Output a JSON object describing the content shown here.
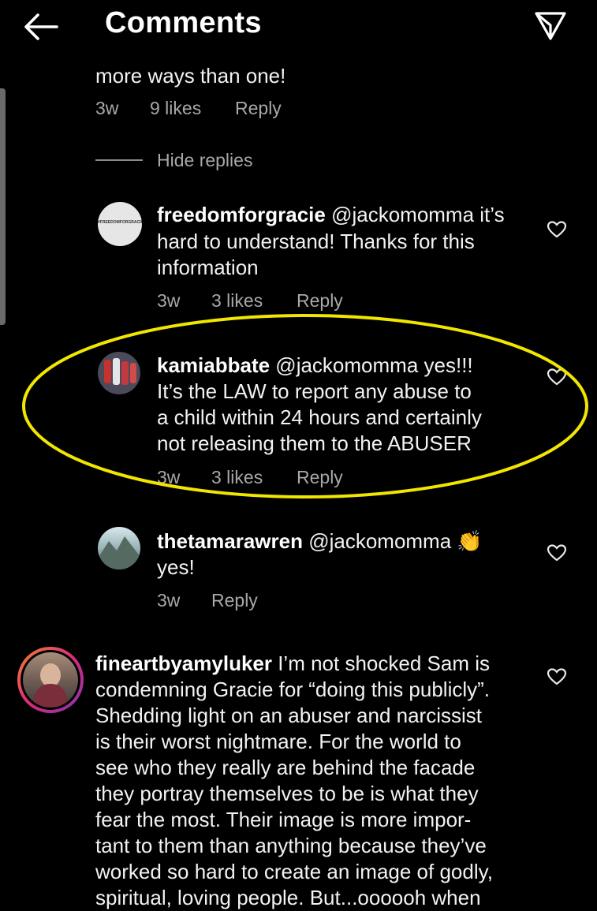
{
  "header": {
    "title": "Comments"
  },
  "top_comment": {
    "tail_text": "more ways than one!",
    "time": "3w",
    "likes": "9 likes",
    "reply_label": "Reply"
  },
  "hide_replies_label": "Hide replies",
  "replies": [
    {
      "username": "freedomforgracie",
      "line1_rest": " @jackomomma it’s",
      "line2": "hard to understand! Thanks for this",
      "line3": "information",
      "time": "3w",
      "likes": "3 likes",
      "reply_label": "Reply",
      "avatar_text": "#FREEDOMFORGRACIE"
    },
    {
      "username": "kamiabbate",
      "line1_rest": " @jackomomma yes!!!",
      "line2": "It’s the LAW to report any abuse to",
      "line3": "a child within 24 hours and certainly",
      "line4": "not releasing them to the ABUSER",
      "time": "3w",
      "likes": "3 likes",
      "reply_label": "Reply"
    },
    {
      "username": "thetamarawren",
      "line1_rest": " @jackomomma 👏",
      "line2": "yes!",
      "time": "3w",
      "reply_label": "Reply"
    }
  ],
  "main_comment": {
    "username": "fineartbyamyluker",
    "lines": [
      " I’m not shocked Sam is",
      "condemning Gracie for “doing this publicly”.",
      "Shedding light on an abuser and narcissist",
      "is their worst nightmare. For the world to",
      "see who they really are behind the facade",
      "they portray themselves to be is what they",
      "fear the most. Their image is more impor-",
      "tant to them than anything because they’ve",
      "worked so hard to create an image of godly,",
      "spiritual, loving people. But...oooooh when"
    ]
  },
  "colors": {
    "background": "#000000",
    "text": "#f2f2f2",
    "meta": "#a8a8a8",
    "highlight_ellipse": "#f2e600",
    "story_ring": "#e1306c"
  },
  "icons": {
    "back": "back-arrow-icon",
    "send": "send-paper-plane-icon",
    "like": "heart-outline-icon"
  }
}
